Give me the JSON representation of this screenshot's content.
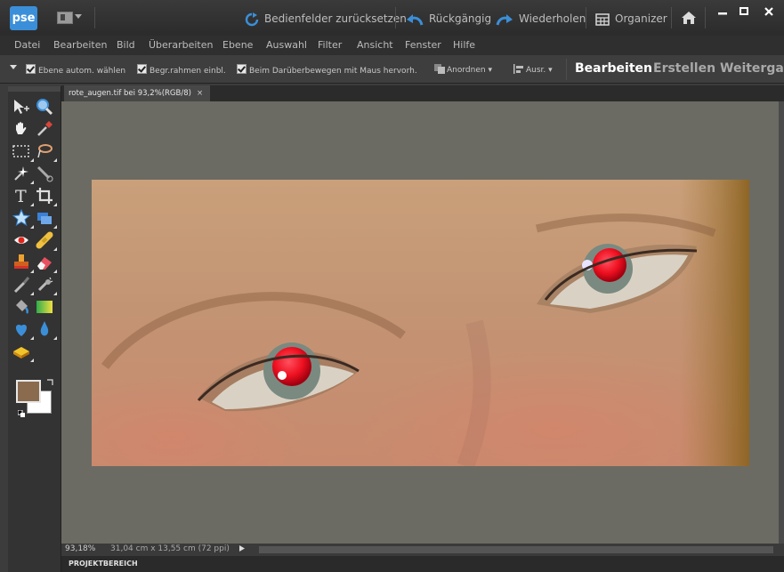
{
  "app": {
    "logo": "pse"
  },
  "titlebar": {
    "reset_panels": "Bedienfelder zurücksetzen",
    "undo": "Rückgängig",
    "redo": "Wiederholen",
    "organizer": "Organizer"
  },
  "menu": [
    "Datei",
    "Bearbeiten",
    "Bild",
    "Überarbeiten",
    "Ebene",
    "Auswahl",
    "Filter",
    "Ansicht",
    "Fenster",
    "Hilfe"
  ],
  "options": {
    "auto_select": "Ebene autom. wählen",
    "bounding_box": "Begr.rahmen einbl.",
    "highlight_hover": "Beim Darüberbewegen mit Maus hervorh.",
    "arrange": "Anordnen",
    "align": "Ausr."
  },
  "mode_tabs": {
    "edit": "Bearbeiten",
    "create": "Erstellen",
    "share": "Weitergabe"
  },
  "document": {
    "tab_title": "rote_augen.tif bei 93,2%(RGB/8)",
    "close": "×"
  },
  "status": {
    "zoom": "93,18%",
    "doc_size": "31,04 cm x 13,55 cm (72 ppi)"
  },
  "project_bin": {
    "label": "PROJEKTBEREICH"
  },
  "colors": {
    "accent": "#3b8fd9",
    "foreground_swatch": "#8b6b4e",
    "background_swatch": "#ffffff",
    "canvas_bg": "#6b6b63"
  },
  "icons": [
    "move-icon",
    "zoom-icon",
    "hand-icon",
    "eyedropper-icon",
    "marquee-icon",
    "lasso-icon",
    "magic-wand-icon",
    "quick-selection-icon",
    "type-icon",
    "crop-icon",
    "custom-shape-icon",
    "straighten-icon",
    "red-eye-icon",
    "healing-brush-icon",
    "clone-stamp-icon",
    "eraser-icon",
    "brush-icon",
    "smart-brush-icon",
    "paint-bucket-icon",
    "gradient-icon",
    "blur-icon",
    "sharpen-icon",
    "sponge-icon"
  ]
}
